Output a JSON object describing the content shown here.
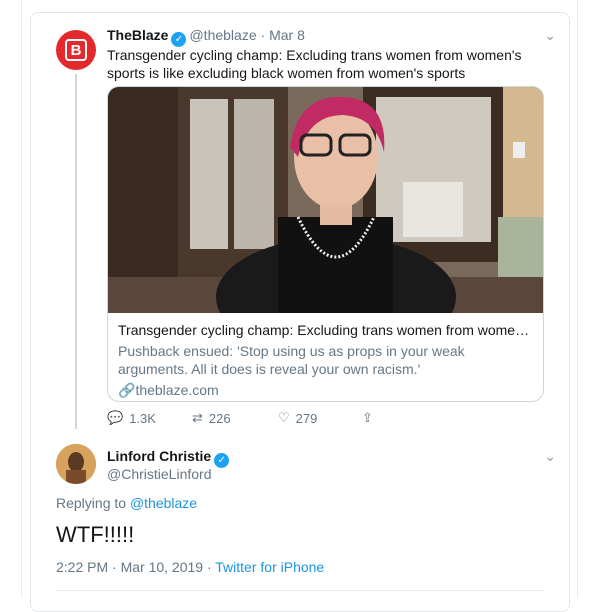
{
  "quoted_tweet": {
    "name": "TheBlaze",
    "handle": "@theblaze",
    "date": "· Mar 8",
    "text": "Transgender cycling champ: Excluding trans women from women's sports is like excluding black women from women's sports",
    "avatar_logo": "B",
    "link_card": {
      "title": "Transgender cycling champ: Excluding trans women from women's s...",
      "description": "Pushback ensued: 'Stop using us as props in your weak arguments. All it does is reveal your own racism.'",
      "domain": "theblaze.com"
    },
    "actions": {
      "replies": "1.3K",
      "retweets": "226",
      "likes": "279"
    }
  },
  "reply_tweet": {
    "name": "Linford Christie",
    "handle": "@ChristieLinford",
    "replying_prefix": "Replying to",
    "replying_to": "@theblaze",
    "text": "WTF!!!!!",
    "timestamp": "2:22 PM · Mar 10, 2019 ·",
    "source": "Twitter for iPhone"
  },
  "colors": {
    "accent": "#1da1f2",
    "blaze_red": "#e3292b",
    "muted": "#657786"
  }
}
